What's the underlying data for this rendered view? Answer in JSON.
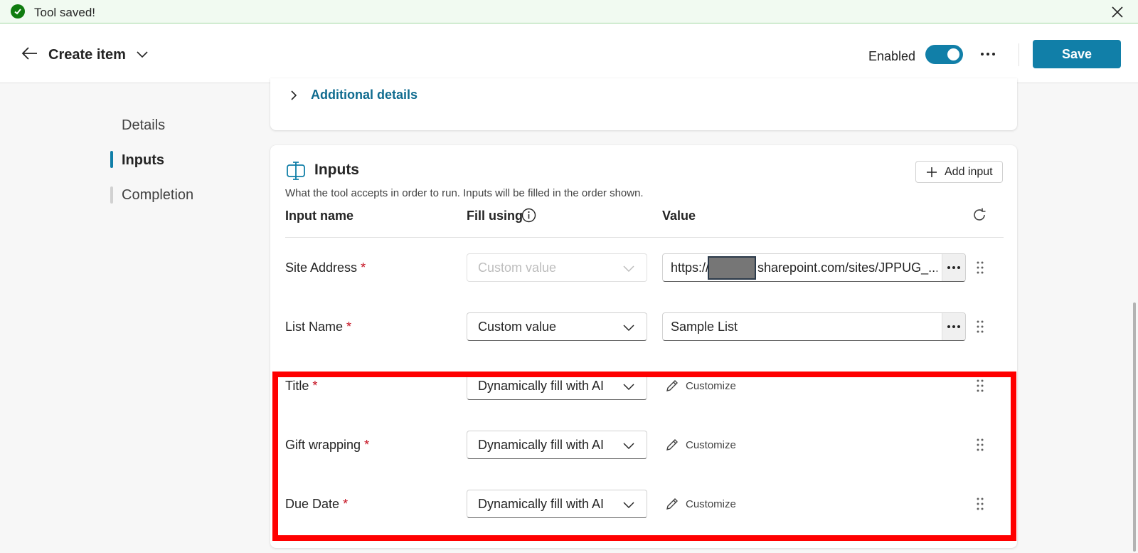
{
  "toast": {
    "message": "Tool saved!"
  },
  "header": {
    "title": "Create item",
    "enabled_label": "Enabled",
    "enabled": true,
    "save_label": "Save"
  },
  "nav": {
    "items": [
      {
        "label": "Details",
        "active": false
      },
      {
        "label": "Inputs",
        "active": true
      },
      {
        "label": "Completion",
        "active": false
      }
    ]
  },
  "additional_details": {
    "label": "Additional details"
  },
  "inputs_section": {
    "title": "Inputs",
    "description": "What the tool accepts in order to run. Inputs will be filled in the order shown.",
    "add_input_label": "Add input",
    "columns": {
      "name": "Input name",
      "fill_using": "Fill using",
      "value": "Value"
    },
    "rows": [
      {
        "name": "Site Address",
        "required": "*",
        "fill_using": "Custom value",
        "value": "https://",
        "value_suffix": "sharepoint.com/sites/JPPUG_..."
      },
      {
        "name": "List Name",
        "required": "*",
        "fill_using": "Custom value",
        "value": "Sample List"
      },
      {
        "name": "Title",
        "required": "*",
        "fill_using": "Dynamically fill with AI",
        "action": "Customize"
      },
      {
        "name": "Gift wrapping",
        "required": "*",
        "fill_using": "Dynamically fill with AI",
        "action": "Customize"
      },
      {
        "name": "Due Date",
        "required": "*",
        "fill_using": "Dynamically fill with AI",
        "action": "Customize"
      }
    ]
  },
  "colors": {
    "accent": "#117fa8",
    "link": "#0f6b8f",
    "required": "#c50f1f",
    "success": "#107c10",
    "highlight": "#ff0000"
  }
}
